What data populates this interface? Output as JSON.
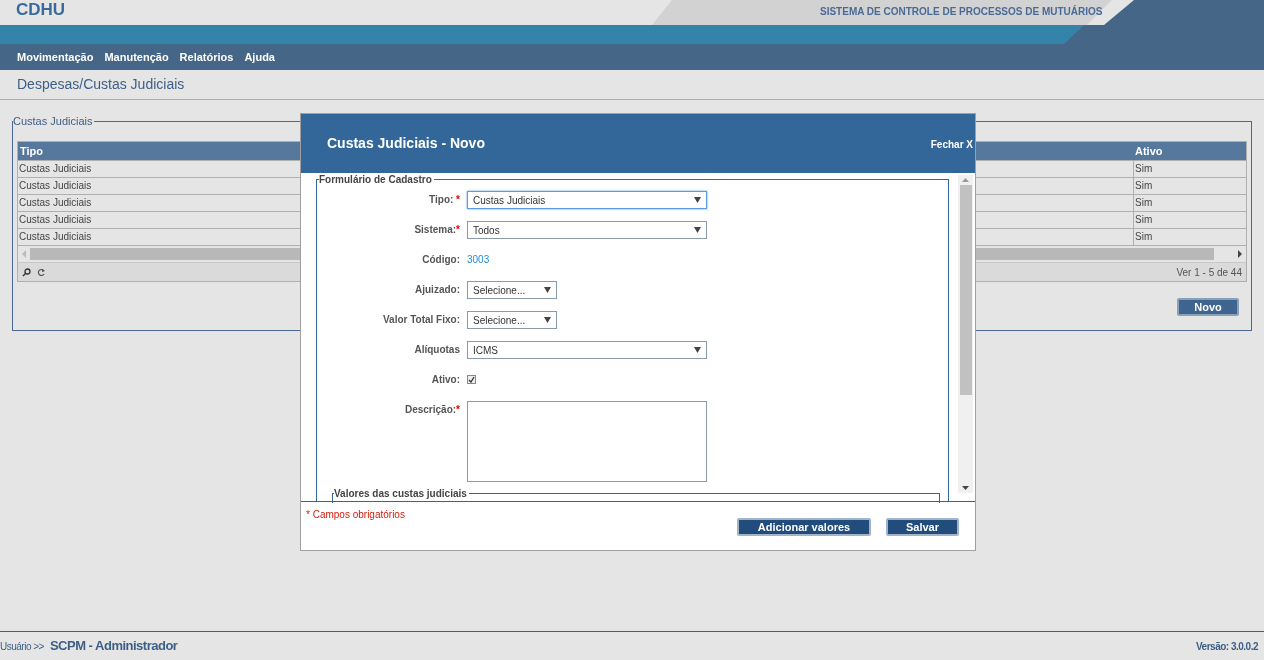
{
  "header": {
    "logo": "CDHU",
    "system_title": "SISTEMA DE CONTROLE DE PROCESSOS DE MUTUÁRIOS"
  },
  "menu": [
    "Movimentação",
    "Manutenção",
    "Relatórios",
    "Ajuda"
  ],
  "page_title": "Despesas/Custas Judiciais",
  "list_panel": {
    "legend": "Custas Judiciais",
    "table": {
      "columns": [
        "Tipo",
        "Ativo"
      ],
      "rows": [
        [
          "Custas Judiciais",
          "Sim"
        ],
        [
          "Custas Judiciais",
          "Sim"
        ],
        [
          "Custas Judiciais",
          "Sim"
        ],
        [
          "Custas Judiciais",
          "Sim"
        ],
        [
          "Custas Judiciais",
          "Sim"
        ]
      ]
    },
    "pager_info": "Ver 1 - 5 de 44",
    "new_button": "Novo"
  },
  "dialog": {
    "title": "Custas Judiciais - Novo",
    "close": "Fechar X",
    "legend": "Formulário de Cadastro",
    "fields": [
      {
        "kind": "select",
        "label": "Tipo:",
        "mark": " *",
        "value": "Custas Judiciais",
        "focused": true
      },
      {
        "kind": "select",
        "label": "Sistema:",
        "mark": "*",
        "value": "Todos",
        "focused": false
      },
      {
        "kind": "text",
        "label": "Código:",
        "value": "3003"
      },
      {
        "kind": "select_short",
        "label": "Ajuizado:",
        "value": "Selecione...",
        "focused": false
      },
      {
        "kind": "select_short",
        "label": "Valor Total Fixo:",
        "value": "Selecione...",
        "focused": false
      },
      {
        "kind": "select",
        "label": "Alíquotas",
        "value": "ICMS",
        "focused": false
      },
      {
        "kind": "checkbox",
        "label": "Ativo:",
        "checked": true
      },
      {
        "kind": "textarea",
        "label": "Descrição:",
        "mark": "*"
      }
    ],
    "sub_legend": "Valores das custas judiciais",
    "required_note": "* Campos obrigatórios",
    "buttons": [
      "Adicionar valores",
      "Salvar"
    ]
  },
  "footer": {
    "user_label": "Usuário >>",
    "user": "SCPM - Administrador",
    "version": "Versão: 3.0.0.2"
  }
}
